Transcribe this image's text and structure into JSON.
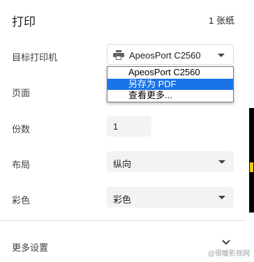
{
  "header": {
    "title": "打印",
    "sheet_count": "1 张纸"
  },
  "destination": {
    "label": "目标打印机",
    "value": "ApeosPort C2560",
    "icon": "printer-icon",
    "options": [
      "ApeosPort C2560",
      "另存为 PDF",
      "查看更多..."
    ],
    "highlighted_option": "另存为 PDF"
  },
  "pages": {
    "label": "页面"
  },
  "copies": {
    "label": "份数",
    "value": "1"
  },
  "layout": {
    "label": "布局",
    "value": "纵向"
  },
  "color": {
    "label": "彩色",
    "value": "彩色"
  },
  "more_settings": {
    "label": "更多设置"
  },
  "watermark": {
    "text": "@很暖影视网"
  },
  "colors": {
    "accent": "#1a73e8",
    "field_bg": "#f1f3f4"
  }
}
